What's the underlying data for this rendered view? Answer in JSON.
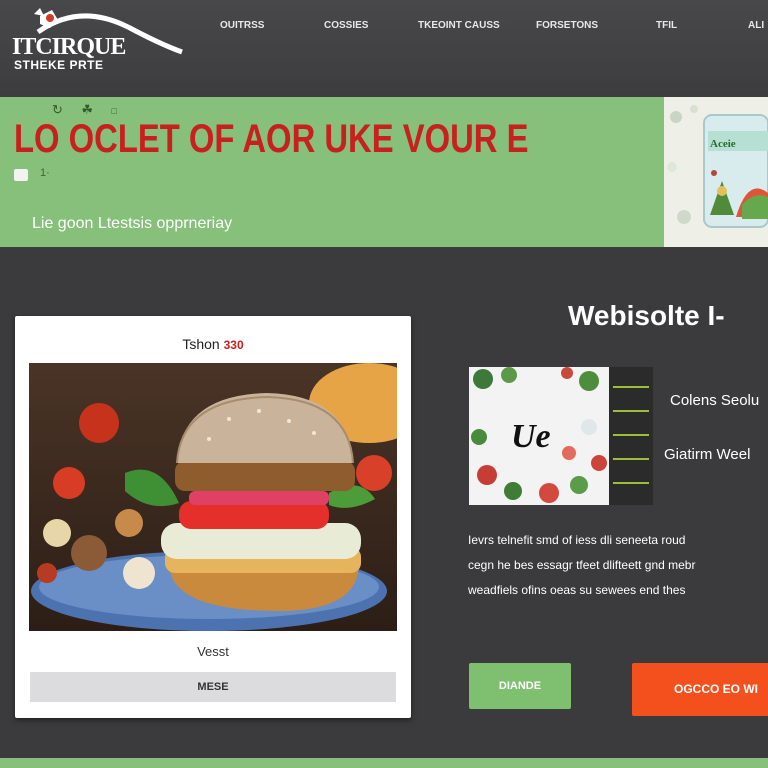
{
  "header": {
    "logo_title": "ITCIRQUE",
    "logo_subtitle": "STHEKE PRTE",
    "nav": [
      {
        "label": "OUITRSS"
      },
      {
        "label": "COSSIES"
      },
      {
        "label": "TKEOINT CAUSS"
      },
      {
        "label": "FORSETONS"
      },
      {
        "label": "TFIL"
      },
      {
        "label": "ALI"
      }
    ]
  },
  "hero": {
    "icons": [
      "refresh-icon",
      "leaf-icon",
      "dot-icon"
    ],
    "title": "LO OCLET OF AOR UKE VOUR E",
    "mini_text": "1·",
    "subtitle": "Lie goon Ltestsis opprneriay",
    "accent_color": "#86c07a",
    "title_color": "#c8201e"
  },
  "card": {
    "title": "Tshon",
    "price": "330",
    "caption": "Vesst",
    "button_label": "MESE"
  },
  "right": {
    "heading": "Webisolte I-",
    "promo_badge": "Ue",
    "features": [
      {
        "label": "Colens Seolu"
      },
      {
        "label": "Giatirm Weel"
      }
    ],
    "description": [
      "Ievrs telnefit smd of iess dli seneeta roud",
      "cegn he bes essagr tfeet dlifteett gnd mebr",
      "weadfiels ofins oeas su sewees end thes"
    ],
    "btn_green": "DIANDE",
    "btn_orange": "OGCCO EO WI",
    "orange_color": "#f4501e"
  }
}
